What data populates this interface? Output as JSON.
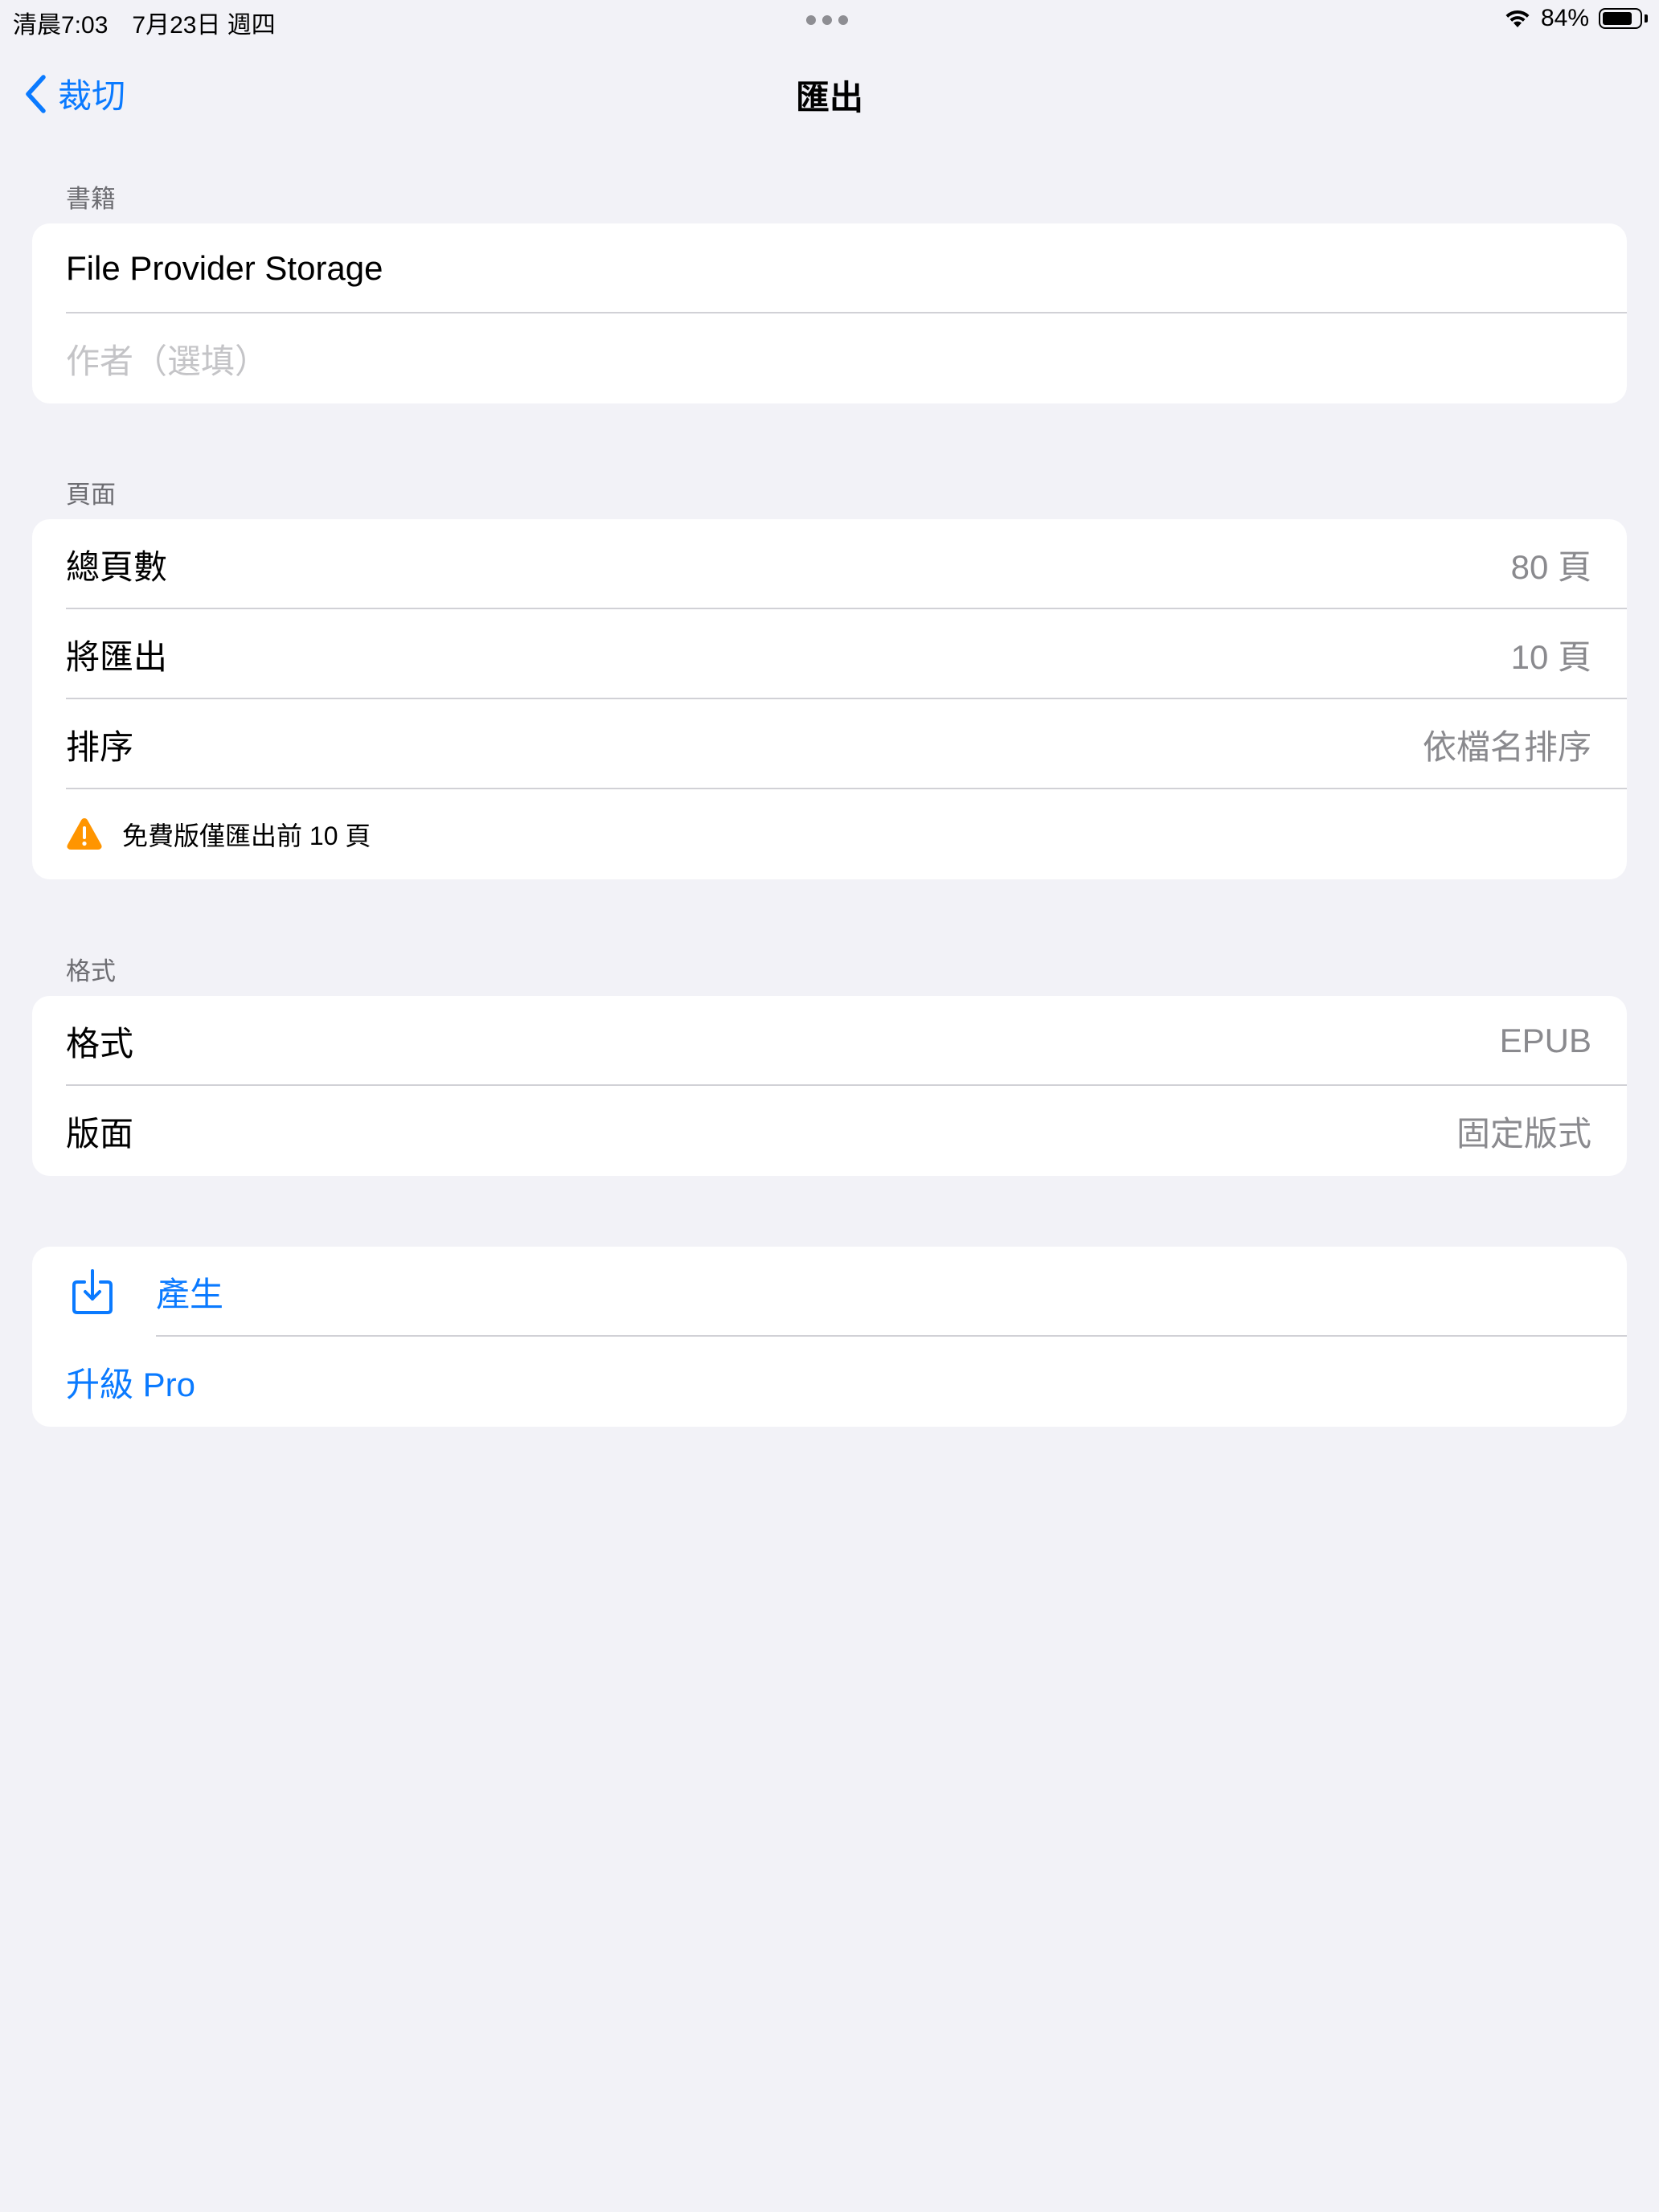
{
  "status_bar": {
    "time": "清晨7:03　7月23日 週四",
    "battery": "84%",
    "battery_level": 0.84
  },
  "nav": {
    "back_label": "裁切",
    "title": "匯出"
  },
  "book_section": {
    "header": "書籍",
    "title_value": "File Provider Storage",
    "author_placeholder": "作者（選填）"
  },
  "pages_section": {
    "header": "頁面",
    "rows": [
      {
        "label": "總頁數",
        "value": "80 頁"
      },
      {
        "label": "將匯出",
        "value": "10 頁"
      },
      {
        "label": "排序",
        "value": "依檔名排序"
      }
    ],
    "warning": "免費版僅匯出前 10 頁"
  },
  "format_section": {
    "header": "格式",
    "rows": [
      {
        "label": "格式",
        "value": "EPUB"
      },
      {
        "label": "版面",
        "value": "固定版式"
      }
    ]
  },
  "actions": {
    "generate": "產生",
    "upgrade": "升級 Pro"
  },
  "colors": {
    "accent": "#0a7aff",
    "warning": "#ff9500",
    "background": "#f2f2f7"
  }
}
